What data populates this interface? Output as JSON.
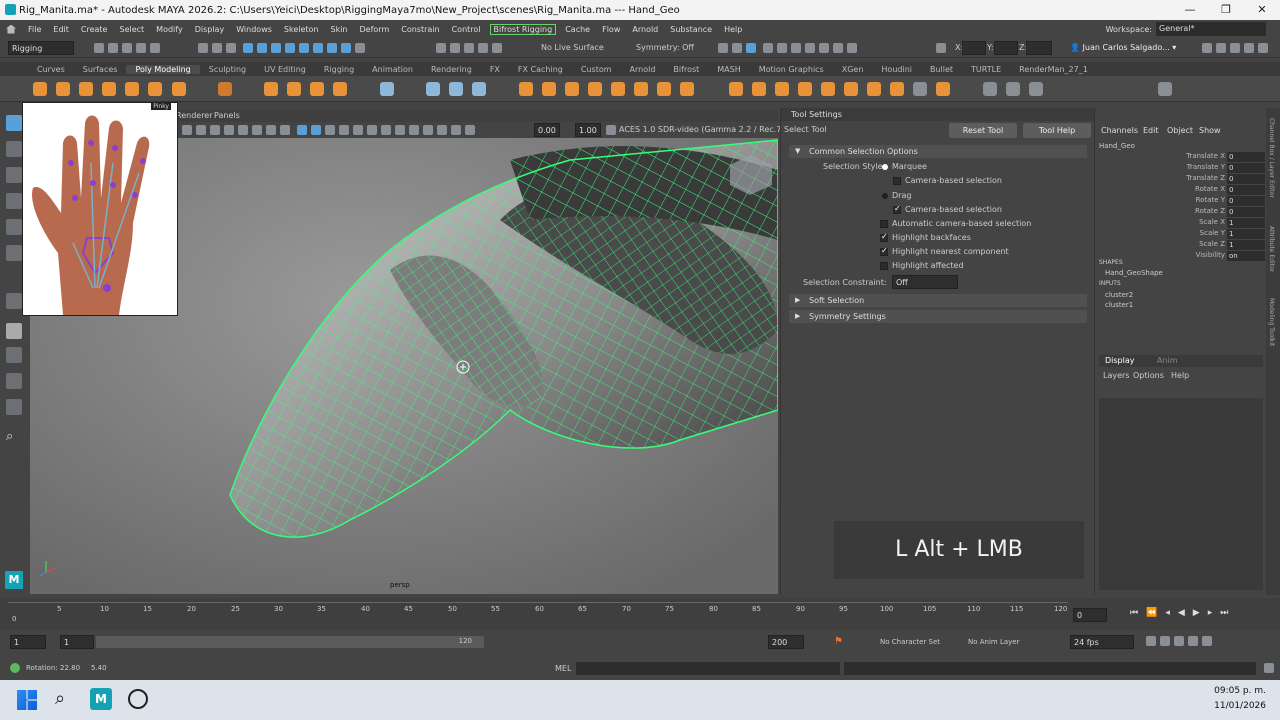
{
  "window": {
    "title": "Rig_Manita.ma* - Autodesk MAYA 2026.2: C:\\Users\\Yeici\\Desktop\\RiggingMaya7mo\\New_Project\\scenes\\Rig_Manita.ma   ---   Hand_Geo",
    "min": "—",
    "max": "❐",
    "close": "✕"
  },
  "menu": {
    "items": [
      "File",
      "Edit",
      "Create",
      "Select",
      "Modify",
      "Display",
      "Windows",
      "Skeleton",
      "Skin",
      "Deform",
      "Constrain",
      "Control",
      "Bifrost Rigging",
      "Cache",
      "Flow",
      "Arnold",
      "Substance",
      "Help"
    ],
    "workspace_label": "Workspace:",
    "workspace_value": "General*"
  },
  "status": {
    "mode": "Rigging",
    "live_surface": "No Live Surface",
    "symmetry": "Symmetry: Off",
    "x_label": "X:",
    "y_label": "Y:",
    "z_label": "Z:",
    "user": "Juan Carlos Salgado..."
  },
  "shelf": {
    "tabs": [
      "Curves",
      "Surfaces",
      "Poly Modeling",
      "Sculpting",
      "UV Editing",
      "Rigging",
      "Animation",
      "Rendering",
      "FX",
      "FX Caching",
      "Custom",
      "Arnold",
      "Bifrost",
      "MASH",
      "Motion Graphics",
      "XGen",
      "Houdini",
      "Bullet",
      "TURTLE",
      "RenderMan_27_1"
    ],
    "active": "Poly Modeling"
  },
  "viewport": {
    "menu_items": [
      "Renderer",
      "Panels"
    ],
    "exposure": "0.00",
    "gamma": "1.00",
    "color_space": "ACES 1.0 SDR-video (Gamma 2.2 / Rec.709)",
    "camera": "persp",
    "ref_label": "Pinky"
  },
  "tool_settings": {
    "title": "Tool Settings",
    "tool": "Select Tool",
    "reset": "Reset Tool",
    "help": "Tool Help",
    "section_common": "Common Selection Options",
    "selection_style": "Selection Style:",
    "marquee": "Marquee",
    "camera_based": "Camera-based selection",
    "drag": "Drag",
    "camera_based2": "Camera-based selection",
    "auto_camera": "Automatic camera-based selection",
    "highlight_backfaces": "Highlight backfaces",
    "highlight_nearest": "Highlight nearest component",
    "highlight_affected": "Highlight affected",
    "constraint_label": "Selection Constraint:",
    "constraint_value": "Off",
    "section_soft": "Soft Selection",
    "section_symmetry": "Symmetry Settings"
  },
  "channel_box": {
    "tabs": [
      "Channels",
      "Edit",
      "Object",
      "Show"
    ],
    "object": "Hand_Geo",
    "attrs": [
      {
        "name": "Translate X",
        "value": "0"
      },
      {
        "name": "Translate Y",
        "value": "0"
      },
      {
        "name": "Translate Z",
        "value": "0"
      },
      {
        "name": "Rotate X",
        "value": "0"
      },
      {
        "name": "Rotate Y",
        "value": "0"
      },
      {
        "name": "Rotate Z",
        "value": "0"
      },
      {
        "name": "Scale X",
        "value": "1"
      },
      {
        "name": "Scale Y",
        "value": "1"
      },
      {
        "name": "Scale Z",
        "value": "1"
      },
      {
        "name": "Visibility",
        "value": "on"
      }
    ],
    "shapes_label": "SHAPES",
    "shape": "Hand_GeoShape",
    "inputs_label": "INPUTS",
    "inputs": [
      "cluster2",
      "cluster1"
    ],
    "layer_tabs": [
      "Display",
      "Anim"
    ],
    "layer_menu": [
      "Layers",
      "Options",
      "Help"
    ]
  },
  "side_strip": [
    "Channel Box / Layer Editor",
    "Attribute Editor",
    "Modeling Toolkit"
  ],
  "hotkey": "L Alt + LMB",
  "timeline": {
    "ticks": [
      "5",
      "10",
      "15",
      "20",
      "25",
      "30",
      "35",
      "40",
      "45",
      "50",
      "55",
      "60",
      "65",
      "70",
      "75",
      "80",
      "85",
      "90",
      "95",
      "100",
      "105",
      "110",
      "115",
      "120"
    ],
    "current_frame": "0",
    "start_label": "0"
  },
  "range": {
    "start": "1",
    "inner_start": "1",
    "inner_end": "120",
    "end": "200",
    "character_set": "No Character Set",
    "anim_layer": "No Anim Layer",
    "fps": "24 fps"
  },
  "command": {
    "status": "Rotation:",
    "v1": "22.80",
    "v2": "5.40",
    "lang": "MEL"
  },
  "taskbar": {
    "time": "09:05 p. m.",
    "date": "11/01/2026"
  }
}
